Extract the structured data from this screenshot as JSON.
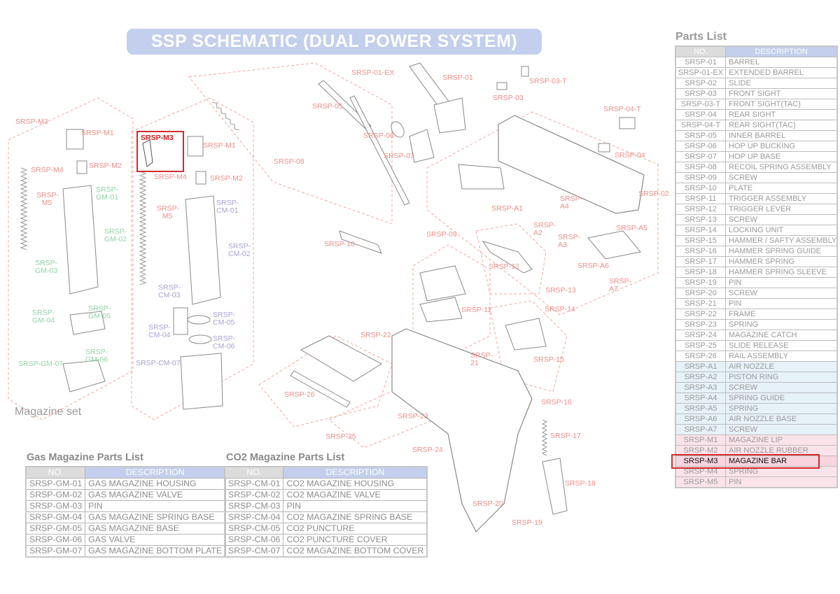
{
  "title": "SSP SCHEMATIC (DUAL POWER SYSTEM)",
  "magazine_set_label": "Magazine set",
  "diagram_labels": {
    "srsp01ex": "SRSP-01-EX",
    "srsp01": "SRSP-01",
    "srsp03t": "SRSP-03-T",
    "srsp03": "SRSP-03",
    "srsp05": "SRSP-05",
    "srsp04t": "SRSP-04-T",
    "srsp06": "SRSP-06",
    "srsp07": "SRSP-07",
    "srsp04": "SRSP-04",
    "srsp08": "SRSP-08",
    "srsp02": "SRSP-02",
    "srspa1": "SRSP-A1",
    "srspa4": "SRSP-A4",
    "srspa2": "SRSP-A2",
    "srspa5": "SRSP-A5",
    "srspa3": "SRSP-A3",
    "srsp09": "SRSP-09",
    "srsp10": "SRSP-10",
    "srsp12": "SRSP-12",
    "srspa6": "SRSP-A6",
    "srspa7": "SRSP-A7",
    "srsp13": "SRSP-13",
    "srsp14": "SRSP-14",
    "srsp11": "SRSP-11",
    "srsp22": "SRSP-22",
    "srsp21": "SRSP-21",
    "srsp15": "SRSP-15",
    "srsp26": "SRSP-26",
    "srsp16": "SRSP-16",
    "srsp23": "SRSP-23",
    "srsp25": "SRSP-25",
    "srsp17": "SRSP-17",
    "srsp24": "SRSP-24",
    "srsp18": "SRSP-18",
    "srsp20": "SRSP-20",
    "srsp19": "SRSP-19",
    "gas_m3": "SRSP-M3",
    "gas_m1": "SRSP-M1",
    "gas_m2": "SRSP-M2",
    "gas_m4": "SRSP-M4",
    "gas_m5": "SRSP-M5",
    "gm01": "SRSP-GM-01",
    "gm02": "SRSP-GM-02",
    "gm03": "SRSP-GM-03",
    "gm04": "SRSP-GM-04",
    "gm05": "SRSP-GM-05",
    "gm06": "SRSP-GM-06",
    "gm07": "SRSP-GM-07",
    "co2_m3": "SRSP-M3",
    "co2_m1": "SRSP-M1",
    "co2_m2": "SRSP-M2",
    "co2_m4": "SRSP-M4",
    "co2_m5": "SRSP-M5",
    "cm01": "SRSP-CM-01",
    "cm02": "SRSP-CM-02",
    "cm03": "SRSP-CM-03",
    "cm04": "SRSP-CM-04",
    "cm05": "SRSP-CM-05",
    "cm06": "SRSP-CM-06",
    "cm07": "SRSP-CM-07"
  },
  "gas_table": {
    "title": "Gas Magazine Parts List",
    "headers": [
      "NO.",
      "DESCRIPTION"
    ],
    "rows": [
      [
        "SRSP-GM-01",
        "GAS MAGAZINE HOUSING"
      ],
      [
        "SRSP-GM-02",
        "GAS MAGAZINE VALVE"
      ],
      [
        "SRSP-GM-03",
        "PIN"
      ],
      [
        "SRSP-GM-04",
        "GAS MAGAZINE SPRING BASE"
      ],
      [
        "SRSP-GM-05",
        "GAS MAGAZINE BASE"
      ],
      [
        "SRSP-GM-06",
        "GAS VALVE"
      ],
      [
        "SRSP-GM-07",
        "GAS MAGAZINE BOTTOM PLATE"
      ]
    ]
  },
  "co2_table": {
    "title": "CO2 Magazine Parts List",
    "headers": [
      "NO.",
      "DESCRIPTION"
    ],
    "rows": [
      [
        "SRSP-CM-01",
        "CO2 MAGAZINE HOUSING"
      ],
      [
        "SRSP-CM-02",
        "CO2 MAGAZINE VALVE"
      ],
      [
        "SRSP-CM-03",
        "PIN"
      ],
      [
        "SRSP-CM-04",
        "CO2 MAGAZINE SPRING BASE"
      ],
      [
        "SRSP-CM-05",
        "CO2 PUNCTURE"
      ],
      [
        "SRSP-CM-06",
        "CO2 PUNCTURE COVER"
      ],
      [
        "SRSP-CM-07",
        "CO2 MAGAZINE BOTTOM COVER"
      ]
    ]
  },
  "parts_list": {
    "title": "Parts List",
    "headers": [
      "NO.",
      "DESCRIPTION"
    ],
    "rows": [
      [
        "SRSP-01",
        "BARREL"
      ],
      [
        "SRSP-01-EX",
        "EXTENDED BARREL"
      ],
      [
        "SRSP-02",
        "SLIDE"
      ],
      [
        "SRSP-03",
        "FRONT SIGHT"
      ],
      [
        "SRSP-03-T",
        "FRONT SIGHT(TAC)"
      ],
      [
        "SRSP-04",
        "REAR SIGHT"
      ],
      [
        "SRSP-04-T",
        "REAR SIGHT(TAC)"
      ],
      [
        "SRSP-05",
        "INNER BARREL"
      ],
      [
        "SRSP-06",
        "HOP UP BUCKING"
      ],
      [
        "SRSP-07",
        "HOP UP BASE"
      ],
      [
        "SRSP-08",
        "RECOIL SPRING ASSEMBLY"
      ],
      [
        "SRSP-09",
        "SCREW"
      ],
      [
        "SRSP-10",
        "PLATE"
      ],
      [
        "SRSP-11",
        "TRIGGER ASSEMBLY"
      ],
      [
        "SRSP-12",
        "TRIGGER LEVER"
      ],
      [
        "SRSP-13",
        "SCREW"
      ],
      [
        "SRSP-14",
        "LOCKING UNIT"
      ],
      [
        "SRSP-15",
        "HAMMER / SAFTY ASSEMBLY"
      ],
      [
        "SRSP-16",
        "HAMMER SPRING GUIDE"
      ],
      [
        "SRSP-17",
        "HAMMER SPRING"
      ],
      [
        "SRSP-18",
        "HAMMER SPRING SLEEVE"
      ],
      [
        "SRSP-19",
        "PIN"
      ],
      [
        "SRSP-20",
        "SCREW"
      ],
      [
        "SRSP-21",
        "PIN"
      ],
      [
        "SRSP-22",
        "FRAME"
      ],
      [
        "SRSP-23",
        "SPRING"
      ],
      [
        "SRSP-24",
        "MAGAZINE CATCH"
      ],
      [
        "SRSP-25",
        "SLIDE RELEASE"
      ],
      [
        "SRSP-26",
        "RAIL ASSEMBLY"
      ],
      [
        "SRSP-A1",
        "AIR NOZZLE"
      ],
      [
        "SRSP-A2",
        "PISTON RING"
      ],
      [
        "SRSP-A3",
        "SCREW"
      ],
      [
        "SRSP-A4",
        "SPRING GUIDE"
      ],
      [
        "SRSP-A5",
        "SPRING"
      ],
      [
        "SRSP-A6",
        "AIR NOZZLE BASE"
      ],
      [
        "SRSP-A7",
        "SCREW"
      ],
      [
        "SRSP-M1",
        "MAGAZINE LIP"
      ],
      [
        "SRSP-M2",
        "AIR NOZZLE RUBBER"
      ],
      [
        "SRSP-M3",
        "MAGAZINE BAR"
      ],
      [
        "SRSP-M4",
        "SPRING"
      ],
      [
        "SRSP-M5",
        "PIN"
      ]
    ],
    "selected_row": "SRSP-M3"
  },
  "colors": {
    "label_red": "#ef8e86",
    "label_green": "#8fd4a5",
    "label_purple": "#a7a1d2",
    "highlight_red": "#d42a2a",
    "header_blue": "#c3cfec",
    "row_blue": "#e6f1f8",
    "row_pink": "#fbe3ea"
  }
}
